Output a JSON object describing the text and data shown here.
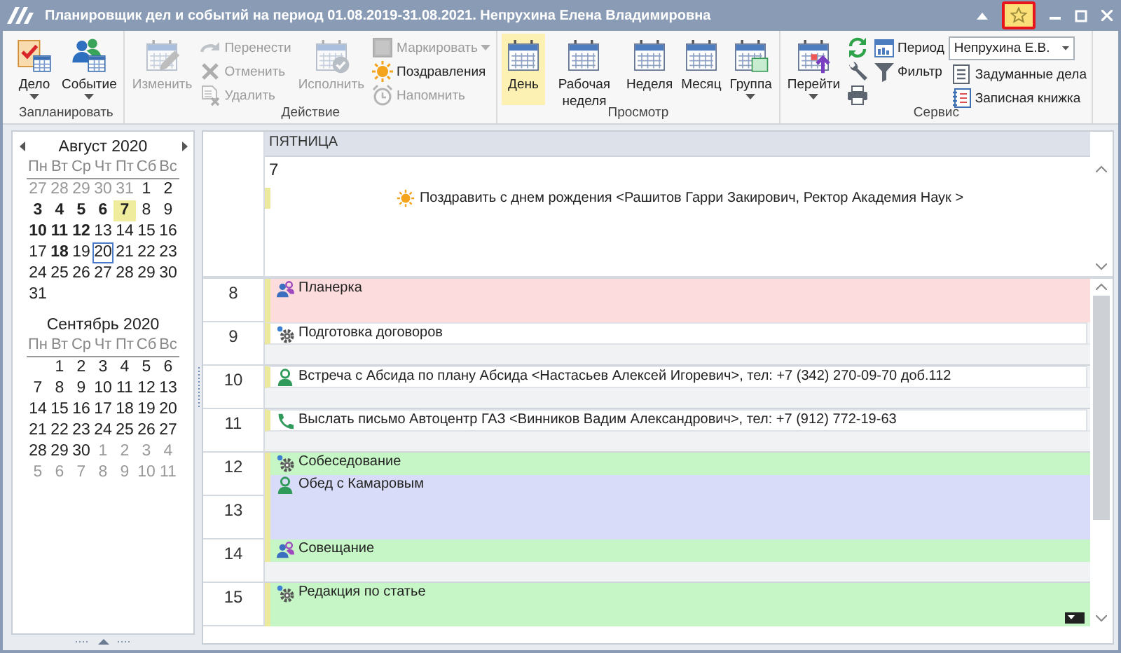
{
  "window": {
    "title": "Планировщик дел и событий на период 01.08.2019-31.08.2021. Непрухина Елена Владимировна",
    "favorite_highlighted": true
  },
  "ribbon": [
    {
      "label": "Запланировать",
      "items": [
        {
          "kind": "large",
          "label": "Дело",
          "disabled": false,
          "dropdown": true
        },
        {
          "kind": "large",
          "label": "Событие",
          "disabled": false,
          "dropdown": true
        }
      ]
    },
    {
      "label": "Действие",
      "items": [
        {
          "kind": "large",
          "label": "Изменить",
          "disabled": true,
          "dropdown": false
        },
        {
          "kind": "stack",
          "buttons": [
            {
              "label": "Перенести",
              "disabled": true,
              "dropdown": false
            },
            {
              "label": "Отменить",
              "disabled": true,
              "dropdown": false
            },
            {
              "label": "Удалить",
              "disabled": true,
              "dropdown": false
            }
          ]
        },
        {
          "kind": "large",
          "label": "Исполнить",
          "disabled": true,
          "dropdown": false
        },
        {
          "kind": "stack",
          "buttons": [
            {
              "label": "Маркировать",
              "disabled": true,
              "dropdown": true
            },
            {
              "label": "Поздравления",
              "disabled": false,
              "dropdown": false
            },
            {
              "label": "Напомнить",
              "disabled": true,
              "dropdown": false
            }
          ]
        }
      ]
    },
    {
      "label": "Просмотр",
      "items": [
        {
          "kind": "large",
          "label": "День",
          "disabled": false,
          "dropdown": false,
          "selected": true
        },
        {
          "kind": "large",
          "label": "Рабочая неделя",
          "disabled": false,
          "dropdown": false,
          "selected": false
        },
        {
          "kind": "large",
          "label": "Неделя",
          "disabled": false,
          "dropdown": false,
          "selected": false
        },
        {
          "kind": "large",
          "label": "Месяц",
          "disabled": false,
          "dropdown": false,
          "selected": false
        },
        {
          "kind": "large",
          "label": "Группа",
          "disabled": false,
          "dropdown": true,
          "selected": false
        }
      ]
    },
    {
      "label": "Сервис",
      "items": [
        {
          "kind": "large",
          "label": "Перейти",
          "disabled": false,
          "dropdown": true
        },
        {
          "kind": "tools"
        },
        {
          "kind": "stack",
          "buttons": [
            {
              "label": "Период",
              "disabled": false,
              "dropdown": false
            },
            {
              "label": "Фильтр",
              "disabled": false,
              "dropdown": false
            }
          ]
        },
        {
          "kind": "combo",
          "value": "Непрухина Е.В.",
          "buttons": [
            {
              "label": "Задуманные дела",
              "disabled": false,
              "dropdown": false
            },
            {
              "label": "Записная книжка",
              "disabled": false,
              "dropdown": false
            }
          ]
        }
      ]
    }
  ],
  "calendar": {
    "months": [
      {
        "title": "Август 2020",
        "arrows": true,
        "weekdays": [
          "Пн",
          "Вт",
          "Ср",
          "Чт",
          "Пт",
          "Сб",
          "Вс"
        ],
        "weeks": [
          [
            {
              "day": "27",
              "muted": true,
              "bold": false,
              "selected": false,
              "today": false
            },
            {
              "day": "28",
              "muted": true,
              "bold": false,
              "selected": false,
              "today": false
            },
            {
              "day": "29",
              "muted": true,
              "bold": false,
              "selected": false,
              "today": false
            },
            {
              "day": "30",
              "muted": true,
              "bold": false,
              "selected": false,
              "today": false
            },
            {
              "day": "31",
              "muted": true,
              "bold": false,
              "selected": false,
              "today": false
            },
            {
              "day": "1",
              "muted": false,
              "bold": false,
              "selected": false,
              "today": false
            },
            {
              "day": "2",
              "muted": false,
              "bold": false,
              "selected": false,
              "today": false
            }
          ],
          [
            {
              "day": "3",
              "muted": false,
              "bold": true,
              "selected": false,
              "today": false
            },
            {
              "day": "4",
              "muted": false,
              "bold": true,
              "selected": false,
              "today": false
            },
            {
              "day": "5",
              "muted": false,
              "bold": true,
              "selected": false,
              "today": false
            },
            {
              "day": "6",
              "muted": false,
              "bold": true,
              "selected": false,
              "today": false
            },
            {
              "day": "7",
              "muted": false,
              "bold": true,
              "selected": true,
              "today": false
            },
            {
              "day": "8",
              "muted": false,
              "bold": false,
              "selected": false,
              "today": false
            },
            {
              "day": "9",
              "muted": false,
              "bold": false,
              "selected": false,
              "today": false
            }
          ],
          [
            {
              "day": "10",
              "muted": false,
              "bold": true,
              "selected": false,
              "today": false
            },
            {
              "day": "11",
              "muted": false,
              "bold": true,
              "selected": false,
              "today": false
            },
            {
              "day": "12",
              "muted": false,
              "bold": true,
              "selected": false,
              "today": false
            },
            {
              "day": "13",
              "muted": false,
              "bold": false,
              "selected": false,
              "today": false
            },
            {
              "day": "14",
              "muted": false,
              "bold": false,
              "selected": false,
              "today": false
            },
            {
              "day": "15",
              "muted": false,
              "bold": false,
              "selected": false,
              "today": false
            },
            {
              "day": "16",
              "muted": false,
              "bold": false,
              "selected": false,
              "today": false
            }
          ],
          [
            {
              "day": "17",
              "muted": false,
              "bold": false,
              "selected": false,
              "today": false
            },
            {
              "day": "18",
              "muted": false,
              "bold": true,
              "selected": false,
              "today": false
            },
            {
              "day": "19",
              "muted": false,
              "bold": false,
              "selected": false,
              "today": false
            },
            {
              "day": "20",
              "muted": false,
              "bold": false,
              "selected": false,
              "today": true
            },
            {
              "day": "21",
              "muted": false,
              "bold": false,
              "selected": false,
              "today": false
            },
            {
              "day": "22",
              "muted": false,
              "bold": false,
              "selected": false,
              "today": false
            },
            {
              "day": "23",
              "muted": false,
              "bold": false,
              "selected": false,
              "today": false
            }
          ],
          [
            {
              "day": "24",
              "muted": false,
              "bold": false,
              "selected": false,
              "today": false
            },
            {
              "day": "25",
              "muted": false,
              "bold": false,
              "selected": false,
              "today": false
            },
            {
              "day": "26",
              "muted": false,
              "bold": false,
              "selected": false,
              "today": false
            },
            {
              "day": "27",
              "muted": false,
              "bold": false,
              "selected": false,
              "today": false
            },
            {
              "day": "28",
              "muted": false,
              "bold": false,
              "selected": false,
              "today": false
            },
            {
              "day": "29",
              "muted": false,
              "bold": false,
              "selected": false,
              "today": false
            },
            {
              "day": "30",
              "muted": false,
              "bold": false,
              "selected": false,
              "today": false
            }
          ],
          [
            {
              "day": "31",
              "muted": false,
              "bold": false,
              "selected": false,
              "today": false
            }
          ]
        ]
      },
      {
        "title": "Сентябрь 2020",
        "arrows": false,
        "weekdays": [
          "Пн",
          "Вт",
          "Ср",
          "Чт",
          "Пт",
          "Сб",
          "Вс"
        ],
        "weeks": [
          [
            {
              "day": "1",
              "muted": false,
              "bold": false,
              "selected": false,
              "today": false
            },
            {
              "day": "2",
              "muted": false,
              "bold": false,
              "selected": false,
              "today": false
            },
            {
              "day": "3",
              "muted": false,
              "bold": false,
              "selected": false,
              "today": false
            },
            {
              "day": "4",
              "muted": false,
              "bold": false,
              "selected": false,
              "today": false
            },
            {
              "day": "5",
              "muted": false,
              "bold": false,
              "selected": false,
              "today": false
            },
            {
              "day": "6",
              "muted": false,
              "bold": false,
              "selected": false,
              "today": false
            }
          ],
          [
            {
              "day": "7",
              "muted": false,
              "bold": false,
              "selected": false,
              "today": false
            },
            {
              "day": "8",
              "muted": false,
              "bold": false,
              "selected": false,
              "today": false
            },
            {
              "day": "9",
              "muted": false,
              "bold": false,
              "selected": false,
              "today": false
            },
            {
              "day": "10",
              "muted": false,
              "bold": false,
              "selected": false,
              "today": false
            },
            {
              "day": "11",
              "muted": false,
              "bold": false,
              "selected": false,
              "today": false
            },
            {
              "day": "12",
              "muted": false,
              "bold": false,
              "selected": false,
              "today": false
            },
            {
              "day": "13",
              "muted": false,
              "bold": false,
              "selected": false,
              "today": false
            }
          ],
          [
            {
              "day": "14",
              "muted": false,
              "bold": false,
              "selected": false,
              "today": false
            },
            {
              "day": "15",
              "muted": false,
              "bold": false,
              "selected": false,
              "today": false
            },
            {
              "day": "16",
              "muted": false,
              "bold": false,
              "selected": false,
              "today": false
            },
            {
              "day": "17",
              "muted": false,
              "bold": false,
              "selected": false,
              "today": false
            },
            {
              "day": "18",
              "muted": false,
              "bold": false,
              "selected": false,
              "today": false
            },
            {
              "day": "19",
              "muted": false,
              "bold": false,
              "selected": false,
              "today": false
            },
            {
              "day": "20",
              "muted": false,
              "bold": false,
              "selected": false,
              "today": false
            }
          ],
          [
            {
              "day": "21",
              "muted": false,
              "bold": false,
              "selected": false,
              "today": false
            },
            {
              "day": "22",
              "muted": false,
              "bold": false,
              "selected": false,
              "today": false
            },
            {
              "day": "23",
              "muted": false,
              "bold": false,
              "selected": false,
              "today": false
            },
            {
              "day": "24",
              "muted": false,
              "bold": false,
              "selected": false,
              "today": false
            },
            {
              "day": "25",
              "muted": false,
              "bold": false,
              "selected": false,
              "today": false
            },
            {
              "day": "26",
              "muted": false,
              "bold": false,
              "selected": false,
              "today": false
            },
            {
              "day": "27",
              "muted": false,
              "bold": false,
              "selected": false,
              "today": false
            }
          ],
          [
            {
              "day": "28",
              "muted": false,
              "bold": false,
              "selected": false,
              "today": false
            },
            {
              "day": "29",
              "muted": false,
              "bold": false,
              "selected": false,
              "today": false
            },
            {
              "day": "30",
              "muted": false,
              "bold": false,
              "selected": false,
              "today": false
            },
            {
              "day": "1",
              "muted": true,
              "bold": false,
              "selected": false,
              "today": false
            },
            {
              "day": "2",
              "muted": true,
              "bold": false,
              "selected": false,
              "today": false
            },
            {
              "day": "3",
              "muted": true,
              "bold": false,
              "selected": false,
              "today": false
            },
            {
              "day": "4",
              "muted": true,
              "bold": false,
              "selected": false,
              "today": false
            }
          ],
          [
            {
              "day": "5",
              "muted": true,
              "bold": false,
              "selected": false,
              "today": false
            },
            {
              "day": "6",
              "muted": true,
              "bold": false,
              "selected": false,
              "today": false
            },
            {
              "day": "7",
              "muted": true,
              "bold": false,
              "selected": false,
              "today": false
            },
            {
              "day": "8",
              "muted": true,
              "bold": false,
              "selected": false,
              "today": false
            },
            {
              "day": "9",
              "muted": true,
              "bold": false,
              "selected": false,
              "today": false
            },
            {
              "day": "10",
              "muted": true,
              "bold": false,
              "selected": false,
              "today": false
            },
            {
              "day": "11",
              "muted": true,
              "bold": false,
              "selected": false,
              "today": false
            }
          ]
        ]
      }
    ]
  },
  "day_view": {
    "weekday": "ПЯТНИЦА",
    "date": "7",
    "all_day_events": [
      {
        "title": "Поздравить с днем рождения <Рашитов Гарри Закирович, Ректор Академия Наук >",
        "kind": "birthday"
      }
    ],
    "hours": [
      {
        "label": "8",
        "events": [
          {
            "title": "Планерка",
            "kind": "meeting",
            "half_past": false,
            "half_hour": false,
            "spans_next_hour": false,
            "color": "#fcdcdc"
          }
        ]
      },
      {
        "label": "9",
        "events": [
          {
            "title": "Подготовка договоров",
            "kind": "task",
            "half_past": false,
            "half_hour": true,
            "spans_next_hour": false,
            "color": "#ffffff"
          }
        ]
      },
      {
        "label": "10",
        "events": [
          {
            "title": "Встреча с Абсида по плану Абсида <Настасьев Алексей Игоревич>, тел: +7 (342) 270-09-70 доб.112",
            "kind": "person",
            "half_past": false,
            "half_hour": true,
            "spans_next_hour": false,
            "color": "#ffffff"
          }
        ]
      },
      {
        "label": "11",
        "events": [
          {
            "title": "Выслать письмо Автоцентр ГАЗ <Винников Вадим Александрович>, тел: +7 (912) 772-19-63",
            "kind": "call",
            "half_past": false,
            "half_hour": true,
            "spans_next_hour": false,
            "color": "#ffffff"
          }
        ]
      },
      {
        "label": "12",
        "events": [
          {
            "title": "Собеседование",
            "kind": "task",
            "half_past": false,
            "half_hour": true,
            "spans_next_hour": false,
            "color": "#c6f5c6"
          },
          {
            "title": "Обед с Камаровым",
            "kind": "person",
            "half_past": true,
            "half_hour": false,
            "spans_next_hour": true,
            "color": "#d9dcf8"
          }
        ]
      },
      {
        "label": "13"
      },
      {
        "label": "14",
        "events": [
          {
            "title": "Совещание",
            "kind": "meeting",
            "half_past": false,
            "half_hour": true,
            "spans_next_hour": false,
            "color": "#c6f5c6"
          }
        ]
      },
      {
        "label": "15",
        "events": [
          {
            "title": "Редакция по статье",
            "kind": "task",
            "half_past": false,
            "half_hour": false,
            "spans_next_hour": false,
            "color": "#c6f5c6"
          }
        ]
      }
    ]
  }
}
